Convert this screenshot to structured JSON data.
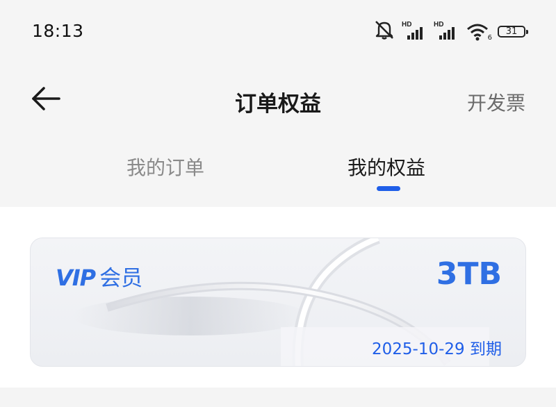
{
  "status_bar": {
    "time": "18:13",
    "signal1_label": "HD",
    "signal2_label": "HD",
    "wifi_label": "6",
    "battery": "31",
    "icons": [
      "bell-muted-icon",
      "signal-icon",
      "signal-icon",
      "wifi-icon",
      "battery-icon"
    ]
  },
  "header": {
    "back_icon": "arrow-left-icon",
    "title": "订单权益",
    "action_label": "开发票"
  },
  "tabs": {
    "items": [
      {
        "label": "我的订单",
        "active": false
      },
      {
        "label": "我的权益",
        "active": true
      }
    ],
    "accent_color": "#1f5ee8"
  },
  "vip_card": {
    "vip_mark": "VIP",
    "label": "会员",
    "capacity": "3TB",
    "expiry": "2025-10-29 到期",
    "accent_color": "#2f6fe3"
  }
}
